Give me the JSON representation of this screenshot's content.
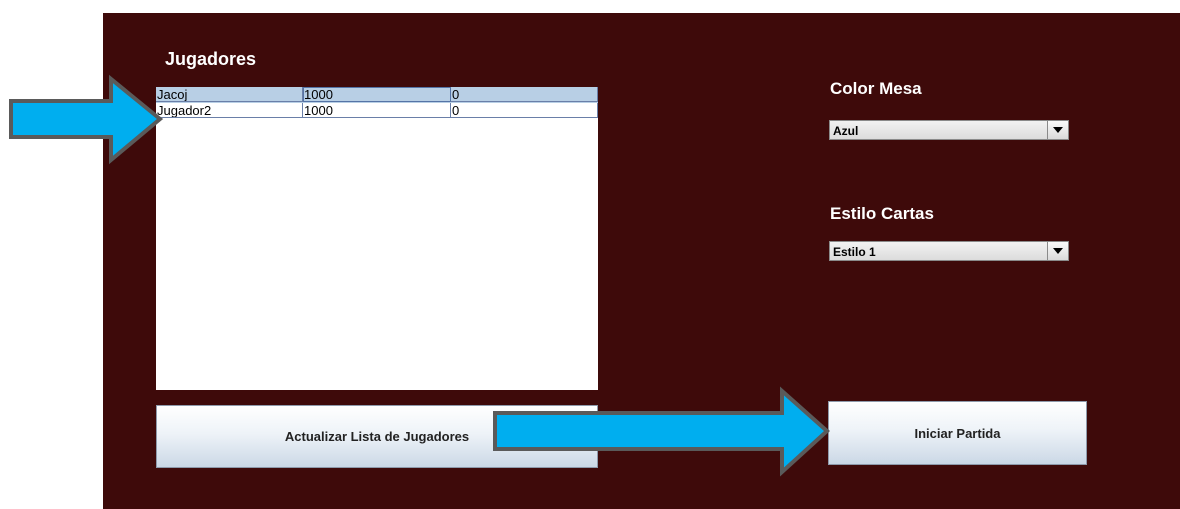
{
  "players": {
    "title": "Jugadores",
    "rows": [
      {
        "name": "Jacoj",
        "chips": "1000",
        "score": "0"
      },
      {
        "name": "Jugador2",
        "chips": "1000",
        "score": "0"
      }
    ]
  },
  "table_color": {
    "title": "Color Mesa",
    "selected": "Azul"
  },
  "card_style": {
    "title": "Estilo Cartas",
    "selected": "Estilo 1"
  },
  "buttons": {
    "refresh": "Actualizar Lista de Jugadores",
    "start": "Iniciar Partida"
  },
  "colors": {
    "panel_bg": "#3e0a0a",
    "arrow_fill": "#00aeef",
    "arrow_stroke": "#5a5a5a",
    "selected_row": "#b8cfe5"
  },
  "icons": [
    "arrow-right-icon",
    "dropdown-arrow-icon"
  ]
}
